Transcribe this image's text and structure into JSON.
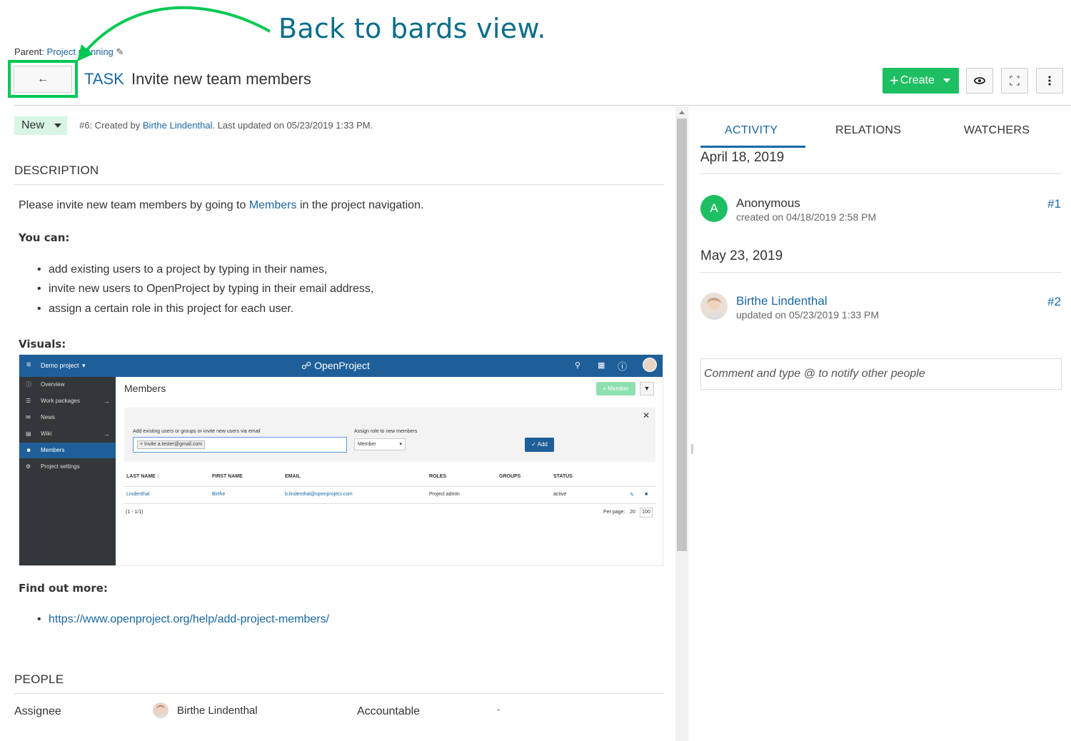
{
  "annotation": {
    "text": "Back to bards view.",
    "color": "#0a6e8a",
    "arrow_color": "#00c853"
  },
  "header": {
    "parent_label": "Parent:",
    "parent_link": "Project planning",
    "back_icon": "arrow-left-icon",
    "type": "TASK",
    "subject": "Invite new team members",
    "create_label": "Create",
    "watch_icon": "eye-icon",
    "fullscreen_icon": "fullscreen-icon",
    "more_icon": "vertical-dots-icon"
  },
  "details": {
    "status": "New",
    "meta_prefix": "#6: Created by ",
    "meta_author": "Birthe Lindenthal",
    "meta_suffix": ". Last updated on 05/23/2019 1:33 PM.",
    "description_title": "DESCRIPTION",
    "intro_prefix": "Please invite new team members by going to ",
    "intro_link": "Members",
    "intro_suffix": " in the project navigation.",
    "you_can": "You can:",
    "bullets": [
      "add existing users to a project by typing in their names,",
      "invite new users to OpenProject by typing in their email address,",
      "assign a certain role in this project for each user."
    ],
    "visuals": "Visuals:",
    "find_out_more": "Find out more:",
    "find_link": "https://www.openproject.org/help/add-project-members/",
    "people_title": "PEOPLE",
    "assignee_label": "Assignee",
    "assignee_name": "Birthe Lindenthal",
    "accountable_label": "Accountable",
    "accountable_value": "-"
  },
  "visual_screenshot": {
    "project": "Demo project",
    "logo": "OpenProject",
    "nav": [
      "Overview",
      "Work packages",
      "News",
      "Wiki",
      "Members",
      "Project settings"
    ],
    "members_title": "Members",
    "add_member_label": "+ Member",
    "invite_label": "Add existing users or groups or invite new users via email",
    "invite_chip": "× Invite a.tester@gmail.com",
    "role_label": "Assign role to new members",
    "role_value": "Member",
    "add_label": "✓ Add",
    "columns": [
      "LAST NAME ↓",
      "FIRST NAME",
      "EMAIL",
      "ROLES",
      "GROUPS",
      "STATUS"
    ],
    "row": [
      "Lindenthal",
      "Birthe",
      "b.lindenthal@openproject.com",
      "Project admin",
      "",
      "active"
    ],
    "pagination": "(1 - 1/1)",
    "per_page_label": "Per page:",
    "per_page_20": "20",
    "per_page_100": "100"
  },
  "activity": {
    "tabs": [
      "ACTIVITY",
      "RELATIONS",
      "WATCHERS"
    ],
    "entries": [
      {
        "date": "April 18, 2019",
        "avatar": "A",
        "name": "Anonymous",
        "sub": "created on 04/18/2019 2:58 PM",
        "num": "#1"
      },
      {
        "date": "May 23, 2019",
        "avatar": "",
        "name": "Birthe Lindenthal",
        "sub": "updated on 05/23/2019 1:33 PM",
        "num": "#2"
      }
    ],
    "comment_placeholder": "Comment and type @ to notify other people"
  },
  "colors": {
    "accent": "#1a67a3",
    "create_green": "#1ebf62",
    "status_bg": "#d9f5e4",
    "highlight": "#00c853"
  }
}
